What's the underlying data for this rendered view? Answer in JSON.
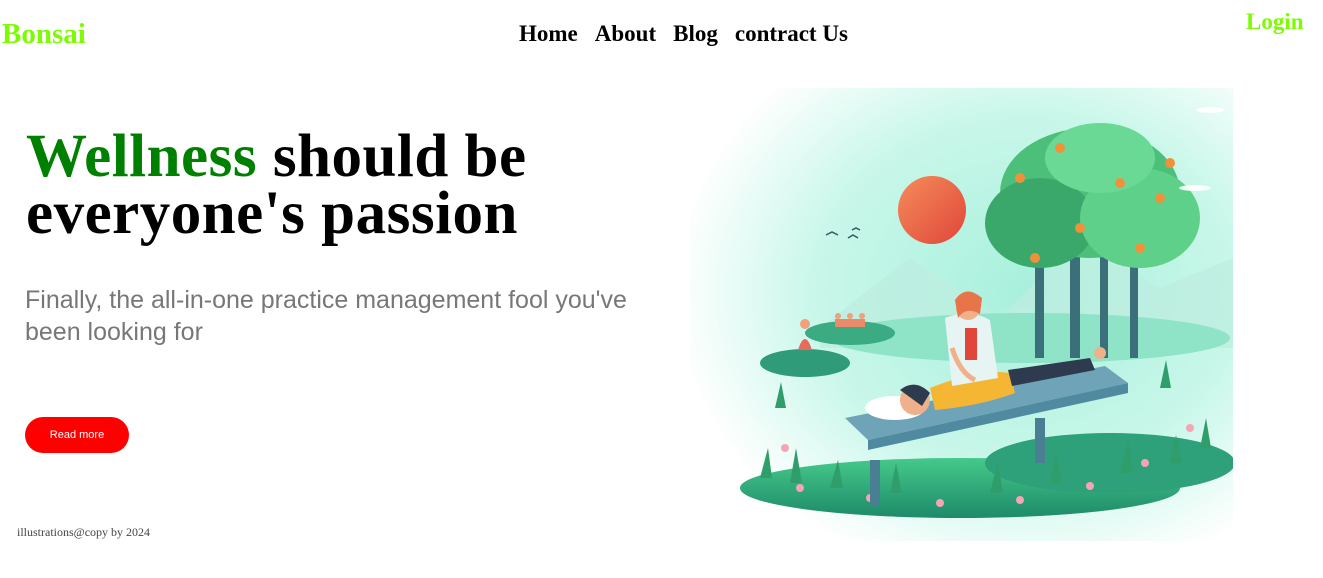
{
  "header": {
    "brand": "Bonsai",
    "nav": [
      {
        "label": "Home"
      },
      {
        "label": "About"
      },
      {
        "label": "Blog"
      },
      {
        "label": "contract Us"
      }
    ],
    "login": "Login"
  },
  "hero": {
    "title_accent": "Wellness",
    "title_line1_rest": " should be",
    "title_line2": "everyone's passion",
    "subtitle": "Finally, the all-in-one practice management fool you've been looking for",
    "cta_label": "Read more"
  },
  "footer": {
    "credit": "illustrations@copy by 2024"
  },
  "colors": {
    "brand": "#7cfc00",
    "accent": "#008000",
    "cta": "#ff0000"
  }
}
